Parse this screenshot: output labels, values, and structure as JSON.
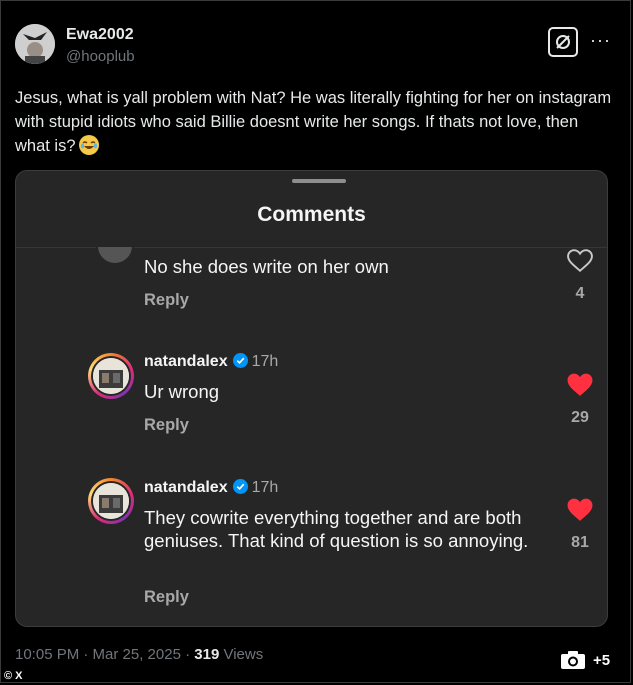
{
  "tweet": {
    "display_name": "Ewa2002",
    "handle": "@hooplub",
    "text": "Jesus, what is yall problem with Nat? He was literally fighting for her on instagram with stupid idiots who said Billie doesnt write her songs. If thats not love, then what is?",
    "emoji": "joy-emoji",
    "timestamp": "10:05 PM · Mar 25, 2025 · ",
    "views_count": "319",
    "views_label": " Views",
    "more_label": "···"
  },
  "comments_panel": {
    "title": "Comments",
    "comments": [
      {
        "username": "",
        "time": "",
        "text": "No she does write on her own",
        "reply_label": "Reply",
        "likes": "4",
        "liked": false
      },
      {
        "username": "natandalex",
        "time": "17h",
        "text": "Ur wrong",
        "reply_label": "Reply",
        "likes": "29",
        "liked": true
      },
      {
        "username": "natandalex",
        "time": "17h",
        "text": "They cowrite everything together and are both geniuses. That kind of question is so annoying.",
        "reply_label": "Reply",
        "likes": "81",
        "liked": true
      }
    ]
  },
  "footer": {
    "photo_count": "+5",
    "source": "© X"
  },
  "colors": {
    "background": "#000000",
    "panel": "#262626",
    "heart_liked": "#ff3040",
    "verified": "#0095f6"
  }
}
